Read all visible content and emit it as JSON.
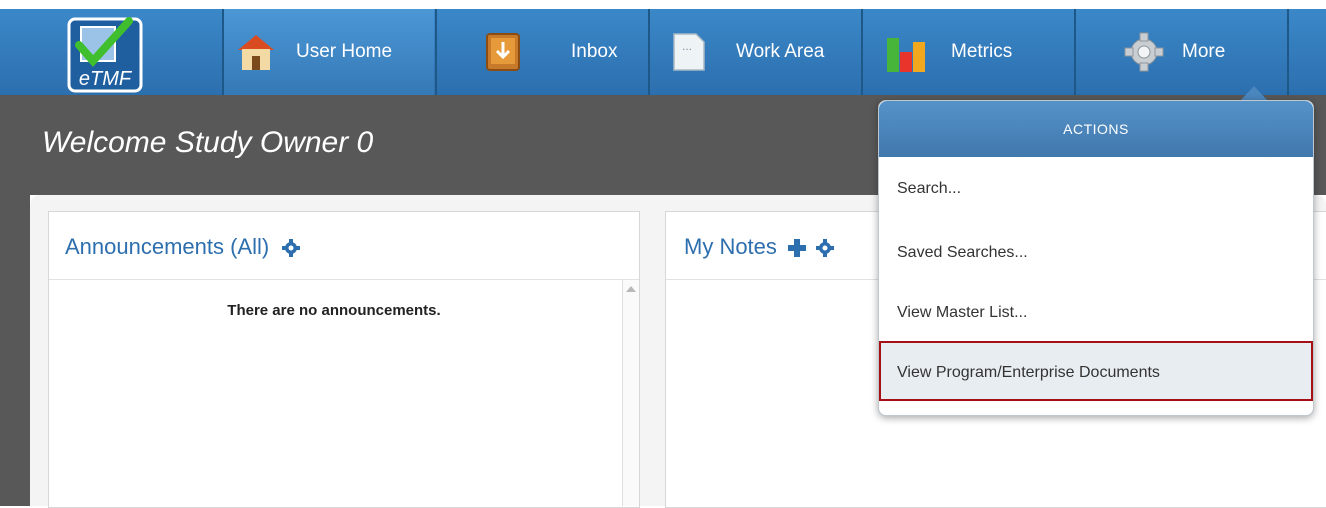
{
  "app": {
    "logo_text": "eTMF"
  },
  "nav": {
    "items": [
      {
        "label": "User Home",
        "icon": "home-icon"
      },
      {
        "label": "Inbox",
        "icon": "inbox-icon"
      },
      {
        "label": "Work Area",
        "icon": "document-icon"
      },
      {
        "label": "Metrics",
        "icon": "bar-chart-icon"
      },
      {
        "label": "More",
        "icon": "gear-icon"
      }
    ]
  },
  "welcome": "Welcome Study Owner 0",
  "announcements": {
    "title": "Announcements (All)",
    "empty_message": "There are no announcements."
  },
  "notes": {
    "title": "My Notes"
  },
  "actions_menu": {
    "header": "ACTIONS",
    "items": [
      "Search...",
      "Saved Searches...",
      "View Master List...",
      "View Program/Enterprise Documents"
    ]
  },
  "colors": {
    "nav_blue": "#2f77b6",
    "banner_grey": "#585858",
    "title_blue": "#2d6fae",
    "highlight_border": "#a60f16"
  }
}
